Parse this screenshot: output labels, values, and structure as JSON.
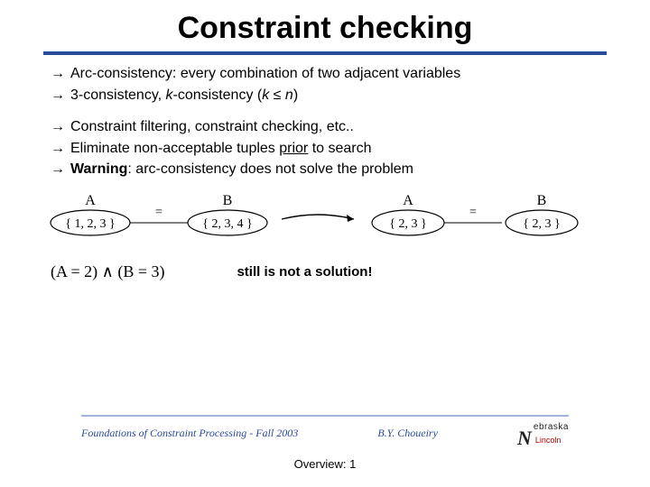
{
  "title": "Constraint checking",
  "bullets1": [
    {
      "text": "Arc-consistency: every combination of two adjacent variables"
    },
    {
      "html": "3-consistency, <span class=\"italic\">k</span>-consistency  (<span class=\"italic\">k</span> ≤ <span class=\"italic\">n</span>)"
    }
  ],
  "bullets2": [
    {
      "text": "Constraint filtering, constraint checking, etc.."
    },
    {
      "html": "Eliminate non-acceptable tuples <span class=\"underline\">prior</span> to search"
    },
    {
      "html": "<span class=\"bold\">Warning</span>: arc-consistency does not solve the problem"
    }
  ],
  "diagram": {
    "left": {
      "A_label": "A",
      "B_label": "B",
      "A_set": "{ 1, 2, 3 }",
      "B_set": "{ 2, 3, 4 }",
      "edge": "="
    },
    "right": {
      "A_label": "A",
      "B_label": "B",
      "A_set": "{ 2, 3 }",
      "B_set": "{ 2, 3 }",
      "edge": "="
    }
  },
  "formula": "(A = 2) ∧ (B = 3)",
  "still_text": "still is not a solution!",
  "footer": {
    "left": "Foundations of Constraint Processing - Fall 2003",
    "right_author": "B.Y. Choueiry",
    "logo_main": "N",
    "logo_rest": "ebraska",
    "logo_sub": "Lincoln"
  },
  "overview": "Overview: 1"
}
